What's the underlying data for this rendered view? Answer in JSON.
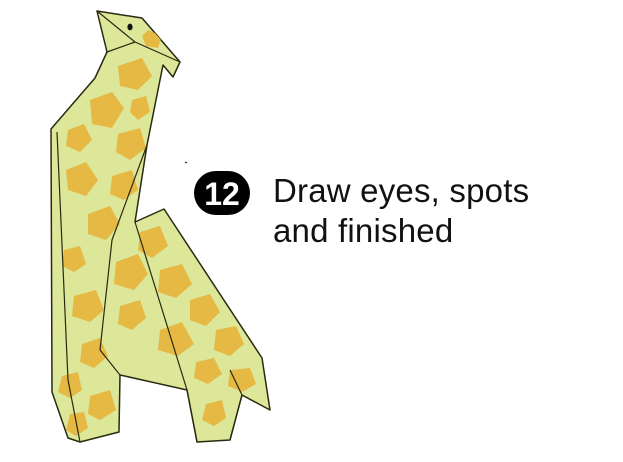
{
  "illustration": {
    "subject": "origami-giraffe",
    "colors": {
      "body": "#dde79a",
      "spots": "#e5b944",
      "outline": "#2a2a10",
      "eye": "#111111"
    }
  },
  "step": {
    "number": "12",
    "badge_color": "#000000",
    "badge_text_color": "#ffffff",
    "line1": "Draw eyes, spots",
    "line2": "and finished"
  }
}
